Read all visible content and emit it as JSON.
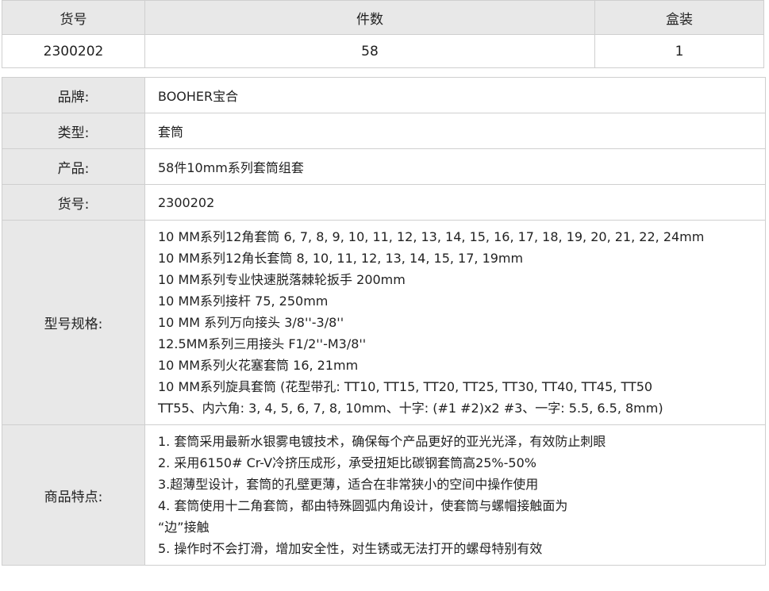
{
  "top": {
    "headers": [
      "货号",
      "件数",
      "盒装"
    ],
    "values": [
      "2300202",
      "58",
      "1"
    ]
  },
  "specs": {
    "brand_label": "品牌:",
    "brand_value": "BOOHER宝合",
    "type_label": "类型:",
    "type_value": "套筒",
    "product_label": "产品:",
    "product_value": "58件10mm系列套筒组套",
    "item_label": "货号:",
    "item_value": "2300202",
    "model_label": "型号规格:",
    "model_lines": [
      "10 MM系列12角套筒 6, 7, 8, 9, 10, 11, 12, 13, 14, 15, 16, 17, 18, 19, 20, 21, 22, 24mm",
      "10 MM系列12角长套筒 8, 10, 11, 12, 13, 14, 15, 17, 19mm",
      "10 MM系列专业快速脱落棘轮扳手 200mm",
      "10 MM系列接杆 75, 250mm",
      "10 MM 系列万向接头 3/8''-3/8''",
      "12.5MM系列三用接头 F1/2''-M3/8''",
      "10 MM系列火花塞套筒 16, 21mm",
      "10 MM系列旋具套筒 (花型带孔: TT10, TT15, TT20, TT25, TT30, TT40, TT45, TT50",
      "TT55、内六角: 3, 4, 5, 6, 7, 8, 10mm、十字: (#1 #2)x2 #3、一字: 5.5, 6.5, 8mm)"
    ],
    "feature_label": "商品特点:",
    "feature_lines": [
      "1. 套筒采用最新水银雾电镀技术，确保每个产品更好的亚光光泽，有效防止刺眼",
      "2. 采用6150# Cr-V冷挤压成形，承受扭矩比碳钢套筒高25%-50%",
      "3.超薄型设计，套筒的孔壁更薄，适合在非常狭小的空间中操作使用",
      "4. 套筒使用十二角套筒，都由特殊圆弧内角设计，使套筒与螺帽接触面为",
      "“边”接触",
      "5. 操作时不会打滑，增加安全性，对生锈或无法打开的螺母特别有效"
    ]
  }
}
